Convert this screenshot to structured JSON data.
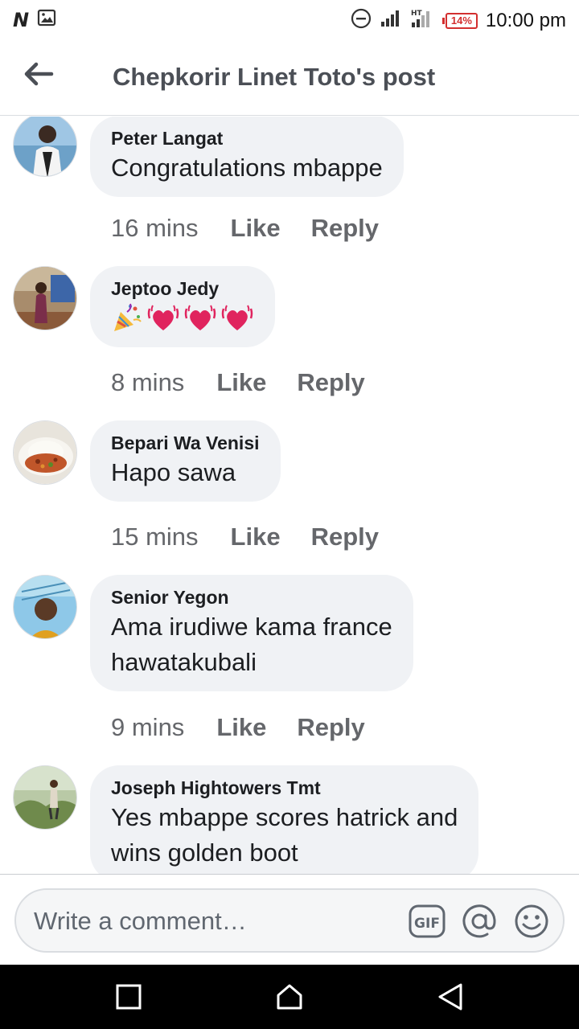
{
  "status_bar": {
    "time": "10:00 pm",
    "battery": "14%",
    "colors": {
      "battery": "#d32f2f"
    },
    "icons": [
      "n-app-icon",
      "gallery-icon",
      "do-not-disturb-icon",
      "signal-icon",
      "signal-ht-icon",
      "battery-icon"
    ]
  },
  "header": {
    "title": "Chepkorir Linet Toto's post",
    "back_icon": "back-arrow-icon"
  },
  "comments": [
    {
      "author": "Peter Langat",
      "text_lines": [
        "Congratulations mbappe"
      ],
      "time": "16 mins",
      "like": "Like",
      "reply": "Reply"
    },
    {
      "author": "Jeptoo Jedy",
      "emojis": [
        "party-popper",
        "beating-heart",
        "beating-heart",
        "beating-heart"
      ],
      "time": "8 mins",
      "like": "Like",
      "reply": "Reply"
    },
    {
      "author": "Bepari Wa Venisi",
      "text_lines": [
        "Hapo sawa"
      ],
      "time": "15 mins",
      "like": "Like",
      "reply": "Reply"
    },
    {
      "author": "Senior Yegon",
      "text_lines": [
        "Ama irudiwe kama france",
        "hawatakubali"
      ],
      "time": "9 mins",
      "like": "Like",
      "reply": "Reply"
    },
    {
      "author": "Joseph Hightowers Tmt",
      "text_lines": [
        "Yes mbappe scores hatrick and",
        "wins golden boot"
      ]
    }
  ],
  "composer": {
    "placeholder": "Write a comment…",
    "gif_label": "GIF",
    "icons": [
      "gif-icon",
      "mention-icon",
      "emoji-icon"
    ]
  },
  "nav": {
    "icons": [
      "recents-square-icon",
      "home-icon",
      "back-triangle-icon"
    ]
  },
  "colors": {
    "bubble": "#f0f2f5",
    "meta": "#65676b",
    "header_text": "#4b4f56"
  }
}
